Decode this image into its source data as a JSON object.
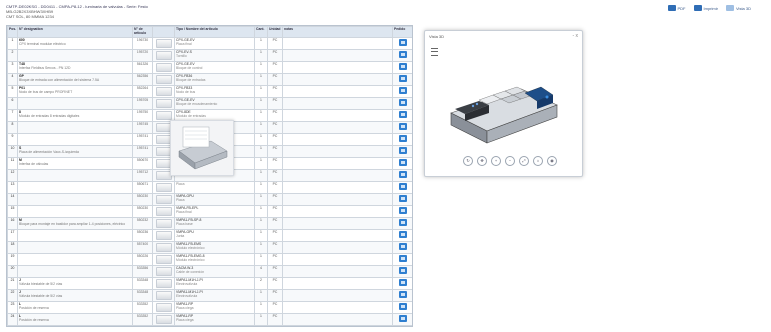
{
  "header": {
    "title": "CMTP-DE02KSG - DD0411 - CMPA-P8-12 - luminaria de valvulas - Serie: Festo",
    "line2": "MB-G2B2X3XBHW3XHB9",
    "line3": "CMT SOL, 80 MMMA 1234"
  },
  "top_actions": [
    {
      "label": "PDF"
    },
    {
      "label": "Imprimir"
    },
    {
      "label": "Vista 3D"
    }
  ],
  "table": {
    "headers": {
      "pos": "Pos.",
      "designation": "N° designation",
      "article": "N° de articulo",
      "picture": "",
      "name": "Tipo / Nombre del articulo",
      "qty": "Cant.",
      "unit": "Unidad",
      "notes": "notas",
      "pick": "Pedido"
    },
    "rows": [
      {
        "pos": "1",
        "code": "600",
        "text": "CPX terminal modular eléctrico",
        "art": "196730",
        "name_code": "CPX-GE-EV",
        "name_text": "Placa final",
        "qty": "1",
        "unit": "PC"
      },
      {
        "pos": "2",
        "code": "",
        "text": "",
        "art": "195720",
        "name_code": "CPX-EV-S",
        "name_text": "Tornillo",
        "qty": "1",
        "unit": "PC"
      },
      {
        "pos": "3",
        "code": "T48",
        "text": "Interfaz Fieldbus Sercos - PN 12D",
        "art": "561326",
        "name_code": "CPX-GE-EV",
        "name_text": "Bloque de control",
        "qty": "1",
        "unit": "PC"
      },
      {
        "pos": "4",
        "code": "GP",
        "text": "Bloque de entrada con alimentación del sistema 7.5A",
        "art": "562356",
        "name_code": "CPX-FB36",
        "name_text": "Bloque de entradas",
        "qty": "1",
        "unit": "PC"
      },
      {
        "pos": "5",
        "code": "P01",
        "text": "Nodo de bus de campo PROFINET",
        "art": "552264",
        "name_code": "CPX-FB33",
        "name_text": "Nodo de bus",
        "qty": "1",
        "unit": "PC"
      },
      {
        "pos": "6",
        "code": "",
        "text": "",
        "art": "195705",
        "name_code": "CPX-GE-EV",
        "name_text": "Bloque de encadenamiento",
        "qty": "1",
        "unit": "PC"
      },
      {
        "pos": "7",
        "code": "8",
        "text": "Módulo de entradas 8 entradas digitales",
        "art": "195750",
        "name_code": "CPX-8DE",
        "name_text": "Módulo de entradas",
        "qty": "1",
        "unit": "PC"
      },
      {
        "pos": "8",
        "code": "",
        "text": "",
        "art": "195745",
        "name_code": "",
        "name_text": "",
        "qty": "1",
        "unit": "PC"
      },
      {
        "pos": "9",
        "code": "",
        "text": "",
        "art": "195741",
        "name_code": "",
        "name_text": "",
        "qty": "1",
        "unit": "PC"
      },
      {
        "pos": "10",
        "code": "S",
        "text": "Placa de alimentación Vaux-S-izquierda",
        "art": "195741",
        "name_code": "",
        "name_text": "",
        "qty": "1",
        "unit": "PC"
      },
      {
        "pos": "11",
        "code": "M",
        "text": "Interfaz de válvulas",
        "art": "550670",
        "name_code": "",
        "name_text": "",
        "qty": "1",
        "unit": "PC"
      },
      {
        "pos": "12",
        "code": "",
        "text": "",
        "art": "195712",
        "name_code": "",
        "name_text": "",
        "qty": "1",
        "unit": "PC"
      },
      {
        "pos": "13",
        "code": "",
        "text": "",
        "art": "550671",
        "name_code": "",
        "name_text": "Placa",
        "qty": "1",
        "unit": "PC"
      },
      {
        "pos": "14",
        "code": "",
        "text": "",
        "art": "550230",
        "name_code": "VMPA-GPU",
        "name_text": "Placa",
        "qty": "1",
        "unit": "PC"
      },
      {
        "pos": "15",
        "code": "",
        "text": "",
        "art": "550230",
        "name_code": "VMPA-FB-EPL",
        "name_text": "Placa final",
        "qty": "1",
        "unit": "PC"
      },
      {
        "pos": "16",
        "code": "M",
        "text": "Bloque para montaje en bastidor para ampliar 1-4 posiciones, eléctrico",
        "art": "550232",
        "name_code": "VMPA1-FB-SP-8",
        "name_text": "Placa base",
        "qty": "1",
        "unit": "PC"
      },
      {
        "pos": "17",
        "code": "",
        "text": "",
        "art": "550236",
        "name_code": "VMPA-GPU",
        "name_text": "Junta",
        "qty": "1",
        "unit": "PC"
      },
      {
        "pos": "18",
        "code": "",
        "text": "",
        "art": "557400",
        "name_code": "VMPA1-FB-EMS",
        "name_text": "Módulo electrónico",
        "qty": "1",
        "unit": "PC"
      },
      {
        "pos": "19",
        "code": "",
        "text": "",
        "art": "550226",
        "name_code": "VMPA1-FB-EMG-8",
        "name_text": "Módulo electrónico",
        "qty": "1",
        "unit": "PC"
      },
      {
        "pos": "20",
        "code": "",
        "text": "",
        "art": "533356",
        "name_code": "CACM-W-3",
        "name_text": "Cable de conexión",
        "qty": "4",
        "unit": "PC"
      },
      {
        "pos": "21",
        "code": "J",
        "text": "Válvula biestable de 5/2 vías",
        "art": "533348",
        "name_code": "VMPA1-M1H-J-PI",
        "name_text": "Electroválvula",
        "qty": "2",
        "unit": "PC"
      },
      {
        "pos": "22",
        "code": "J",
        "text": "Válvula biestable de 5/2 vías",
        "art": "533348",
        "name_code": "VMPA1-M1H-J-PI",
        "name_text": "Electroválvula",
        "qty": "1",
        "unit": "PC"
      },
      {
        "pos": "23",
        "code": "L",
        "text": "Posición de reserva",
        "art": "533352",
        "name_code": "VMPA1-RP",
        "name_text": "Placa ciega",
        "qty": "1",
        "unit": "PC"
      },
      {
        "pos": "24",
        "code": "L",
        "text": "Posición de reserva",
        "art": "533352",
        "name_code": "VMPA1-RP",
        "name_text": "Placa ciega",
        "qty": "1",
        "unit": "PC"
      }
    ]
  },
  "viewer": {
    "title": "Vista 3D",
    "controls": "- x",
    "tools": [
      "rotate-icon",
      "pan-icon",
      "zoom-in-icon",
      "zoom-out-icon",
      "fit-icon",
      "home-icon",
      "camera-icon"
    ]
  }
}
